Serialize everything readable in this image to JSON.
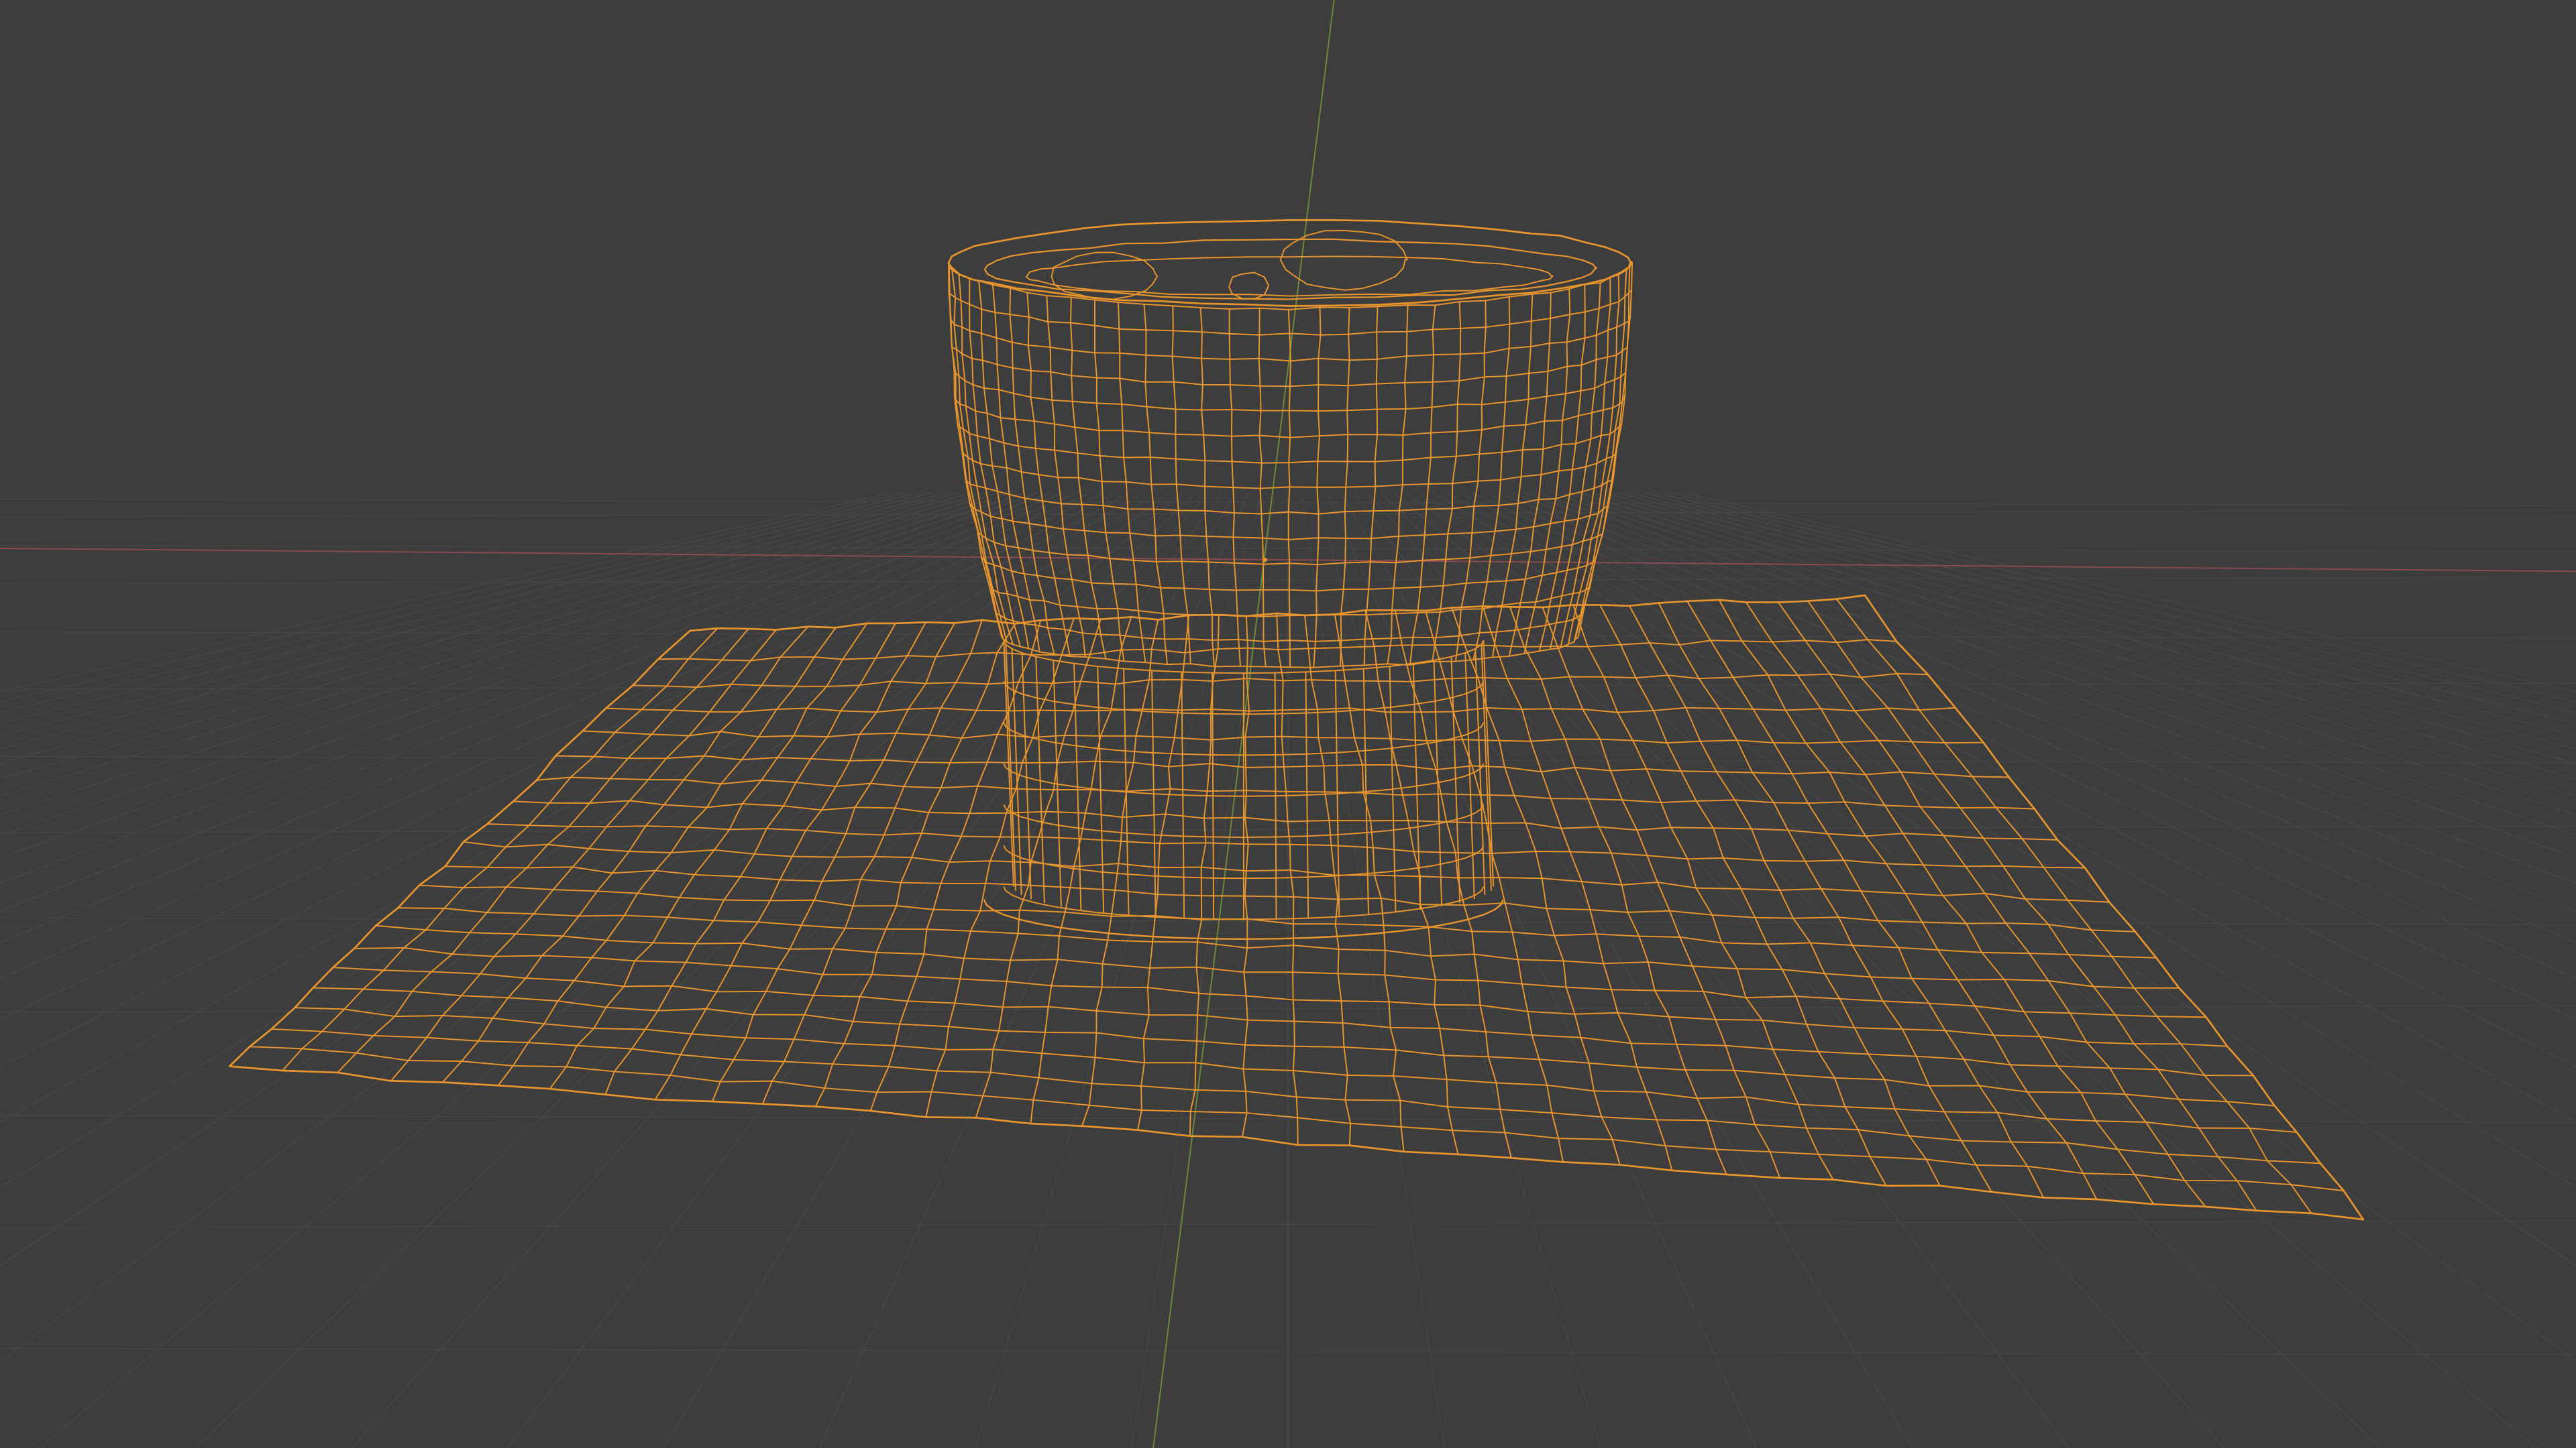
{
  "viewport": {
    "background_color": "#3d3d3d",
    "shading_mode": "wireframe",
    "object_selected": true
  },
  "colors": {
    "wireframe_selected": "#e8952e",
    "grid_floor": "#474747",
    "axis_x": "#8a4a52",
    "axis_y": "#6a8a3a",
    "origin_dot": "#e8952e"
  },
  "object": {
    "shape": "pedestal-bowl-on-ground-plane",
    "icon": "mesh-icon"
  }
}
